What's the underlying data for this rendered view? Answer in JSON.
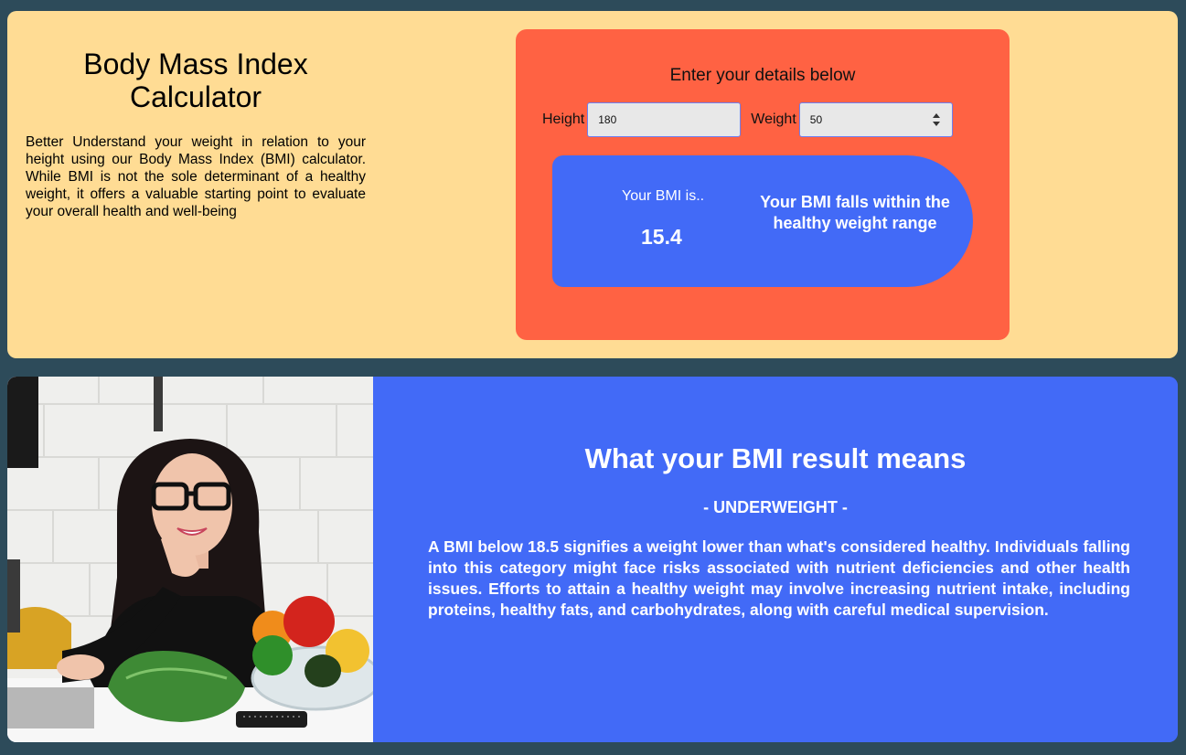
{
  "header": {
    "title": "Body Mass Index Calculator",
    "description": "Better Understand your weight in relation to your height using our Body Mass Index (BMI) calculator. While BMI is not the sole determinant of a healthy weight, it offers a valuable starting point to evaluate your overall health and well-being"
  },
  "calculator": {
    "heading": "Enter your details below",
    "height_label": "Height",
    "height_value": "180",
    "weight_label": "Weight",
    "weight_value": "50",
    "result": {
      "label": "Your BMI is..",
      "value": "15.4",
      "message": "Your BMI falls within the healthy weight range"
    }
  },
  "meaning": {
    "title": "What your BMI result means",
    "category": "- UNDERWEIGHT -",
    "description": "A BMI below 18.5 signifies a weight lower than what's considered healthy. Individuals falling into this category might face risks associated with nutrient deficiencies and other health issues. Efforts to attain a healthy weight may involve increasing nutrient intake, including proteins, healthy fats, and carbohydrates, along with careful medical supervision."
  },
  "colors": {
    "page_bg": "#2d4b5a",
    "top_card_bg": "#ffdc94",
    "calculator_bg": "#ff6243",
    "accent_blue": "#426af7"
  },
  "icons": [
    "number-stepper-icon"
  ]
}
